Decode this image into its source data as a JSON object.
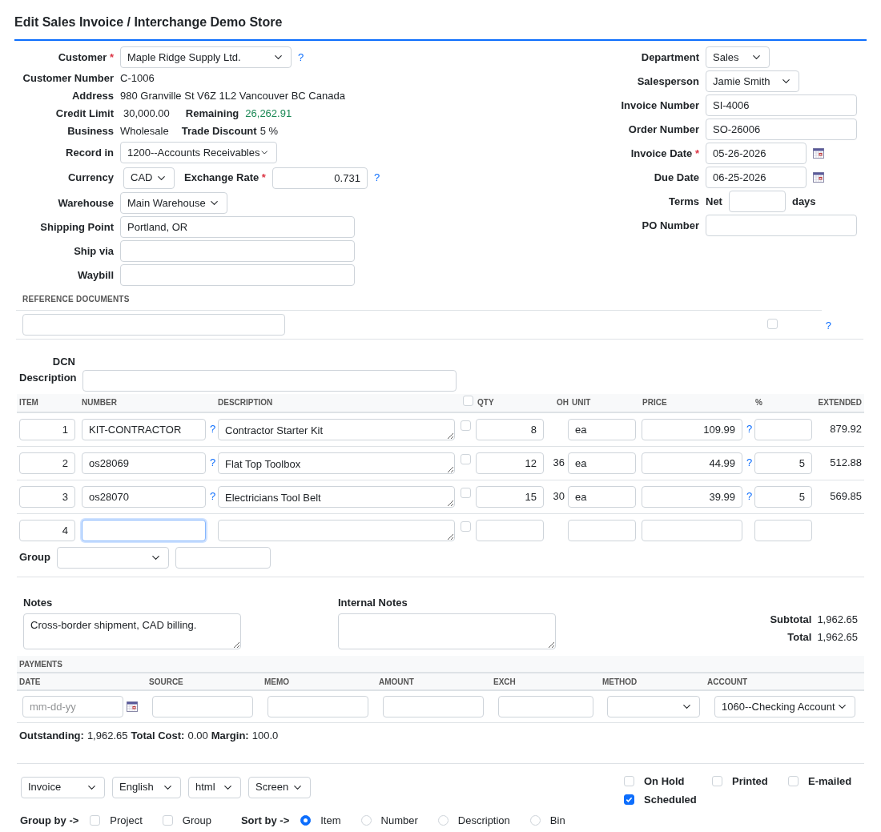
{
  "title": "Edit Sales Invoice / Interchange Demo Store",
  "customer": {
    "label": "Customer",
    "required_mark": "*",
    "value": "Maple Ridge Supply Ltd.",
    "help": "?"
  },
  "customer_number": {
    "label": "Customer Number",
    "value": "C-1006"
  },
  "address": {
    "label": "Address",
    "value": "980 Granville St V6Z 1L2 Vancouver BC Canada"
  },
  "credit": {
    "label": "Credit Limit",
    "value": "30,000.00",
    "remaining_label": "Remaining",
    "remaining": "26,262.91"
  },
  "business": {
    "label": "Business",
    "value": "Wholesale",
    "discount_label": "Trade Discount",
    "discount": "5 %"
  },
  "record_in": {
    "label": "Record in",
    "value": "1200--Accounts Receivables"
  },
  "currency": {
    "label": "Currency",
    "value": "CAD",
    "rate_label": "Exchange Rate",
    "required_mark": "*",
    "rate": "0.731",
    "help": "?"
  },
  "warehouse": {
    "label": "Warehouse",
    "value": "Main Warehouse"
  },
  "shipping_fields": [
    {
      "label": "Shipping Point",
      "value": "Portland, OR"
    },
    {
      "label": "Ship via"
    },
    {
      "label": "Waybill"
    }
  ],
  "department": {
    "label": "Department",
    "value": "Sales"
  },
  "salesperson": {
    "label": "Salesperson",
    "value": "Jamie Smith"
  },
  "invoice_number": {
    "label": "Invoice Number",
    "value": "SI-4006"
  },
  "order_number": {
    "label": "Order Number",
    "value": "SO-26006"
  },
  "invoice_date": {
    "label": "Invoice Date",
    "required_mark": "*",
    "value": "05-26-2026"
  },
  "due_date": {
    "label": "Due Date",
    "value": "06-25-2026"
  },
  "terms": {
    "label": "Terms",
    "prefix": "Net",
    "suffix": "days"
  },
  "po_number": {
    "label": "PO Number"
  },
  "reference_documents": {
    "heading": "REFERENCE DOCUMENTS",
    "checked": false,
    "help": "?"
  },
  "dcn": {
    "label": "DCN",
    "description_label": "Description"
  },
  "lines": {
    "columns": [
      "ITEM",
      "NUMBER",
      "DESCRIPTION",
      "QTY",
      "OH",
      "UNIT",
      "PRICE",
      "%",
      "EXTENDED"
    ],
    "header_checked": false,
    "rows": [
      {
        "item": "1",
        "number": "KIT-CONTRACTOR",
        "help": "?",
        "description": "Contractor Starter Kit",
        "checked": false,
        "qty": "8",
        "unit": "ea",
        "price": "109.99",
        "price_help": "?",
        "extended": "879.92",
        "focused": false
      },
      {
        "item": "2",
        "number": "os28069",
        "help": "?",
        "description": "Flat Top Toolbox",
        "checked": false,
        "qty": "12",
        "oh": "36",
        "unit": "ea",
        "price": "44.99",
        "price_help": "?",
        "discount": "5",
        "extended": "512.88",
        "focused": false
      },
      {
        "item": "3",
        "number": "os28070",
        "help": "?",
        "description": "Electricians Tool Belt",
        "checked": false,
        "qty": "15",
        "oh": "30",
        "unit": "ea",
        "price": "39.99",
        "price_help": "?",
        "discount": "5",
        "extended": "569.85",
        "focused": false
      },
      {
        "item": "4",
        "checked": false,
        "focused": true
      }
    ]
  },
  "group": {
    "label": "Group"
  },
  "notes": {
    "label": "Notes",
    "value": "Cross-border shipment, CAD billing."
  },
  "internal_notes": {
    "label": "Internal Notes"
  },
  "totals": [
    {
      "label": "Subtotal",
      "value": "1,962.65"
    },
    {
      "label": "Total",
      "value": "1,962.65"
    }
  ],
  "payments": {
    "heading": "PAYMENTS",
    "columns": [
      "DATE",
      "SOURCE",
      "MEMO",
      "AMOUNT",
      "EXCH",
      "METHOD",
      "ACCOUNT"
    ],
    "date_placeholder": "mm-dd-yy",
    "account": "1060--Checking Account"
  },
  "summary": [
    {
      "label": "Outstanding:",
      "value": "1,962.65"
    },
    {
      "label": "Total Cost:",
      "value": "0.00"
    },
    {
      "label": "Margin:",
      "value": "100.0"
    }
  ],
  "print_options": [
    "Invoice",
    "English",
    "html",
    "Screen"
  ],
  "flags": [
    {
      "label": "On Hold",
      "checked": false
    },
    {
      "label": "Printed",
      "checked": false
    },
    {
      "label": "E-mailed",
      "checked": false
    },
    {
      "label": "Scheduled",
      "checked": true
    }
  ],
  "group_by": {
    "label": "Group by ->",
    "options": [
      {
        "label": "Project",
        "checked": false
      },
      {
        "label": "Group",
        "checked": false
      }
    ]
  },
  "sort_by": {
    "label": "Sort by ->",
    "options": [
      {
        "label": "Item",
        "selected": true
      },
      {
        "label": "Number",
        "selected": false
      },
      {
        "label": "Description",
        "selected": false
      },
      {
        "label": "Bin",
        "selected": false
      }
    ]
  }
}
